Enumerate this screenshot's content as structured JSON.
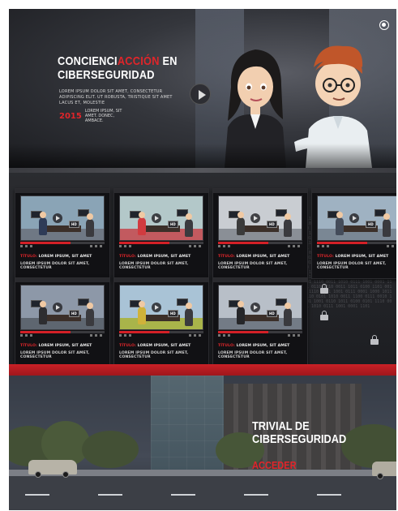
{
  "hero": {
    "title_part1": "CONCIENCI",
    "title_accent": "ACCIÓN",
    "title_part2": " EN",
    "title_line2": "CIBERSEGURIDAD",
    "description": "LOREM IPSUM DOLOR SIT AMET, CONSECTETUR ADIPISCING ELIT. UT ROBUSTA, TRISTIQUE SIT AMET LACUS ET, MOLESTIE",
    "year": "2015",
    "meta_text": "LOREM IPSUM, SIT AMET. DONEC, AMBACE.",
    "icons": {
      "play": "play-icon",
      "corner": "record-icon"
    }
  },
  "videos": [
    {
      "title_accent": "TÍTULO:",
      "title": " LOREM IPSUM, SIT AMET",
      "subtitle": "LOREM IPSUM DOLOR SIT AMET, CONSECTETUR",
      "hd": "HD",
      "progress": 0.6
    },
    {
      "title_accent": "TÍTULO:",
      "title": " LOREM IPSUM, SIT AMET",
      "subtitle": "LOREM IPSUM DOLOR SIT AMET, CONSECTETUR",
      "hd": "HD",
      "progress": 0.6
    },
    {
      "title_accent": "TÍTULO:",
      "title": " LOREM IPSUM, SIT AMET",
      "subtitle": "LOREM IPSUM DOLOR SIT AMET, CONSECTETUR",
      "hd": "HD",
      "progress": 0.6
    },
    {
      "title_accent": "TÍTULO:",
      "title": " LOREM IPSUM, SIT AMET",
      "subtitle": "LOREM IPSUM DOLOR SIT AMET, CONSECTETUR",
      "hd": "HD",
      "progress": 0.6
    },
    {
      "title_accent": "TÍTULO:",
      "title": " LOREM IPSUM, SIT AMET",
      "subtitle": "LOREM IPSUM DOLOR SIT AMET, CONSECTETUR",
      "hd": "HD",
      "progress": 0.6
    },
    {
      "title_accent": "TÍTULO:",
      "title": " LOREM IPSUM, SIT AMET",
      "subtitle": "LOREM IPSUM DOLOR SIT AMET, CONSECTETUR",
      "hd": "HD",
      "progress": 0.6
    },
    {
      "title_accent": "TÍTULO:",
      "title": " LOREM IPSUM, SIT AMET",
      "subtitle": "LOREM IPSUM DOLOR SIT AMET, CONSECTETUR",
      "hd": "HD",
      "progress": 0.6
    }
  ],
  "trivial": {
    "title_line1": "TRIVIAL DE",
    "title_line2": "CIBERSEGURIDAD",
    "button": "ACCEDER"
  },
  "colors": {
    "accent": "#e0252a",
    "dark": "#1a1a1c",
    "redbar": "#c92026"
  }
}
